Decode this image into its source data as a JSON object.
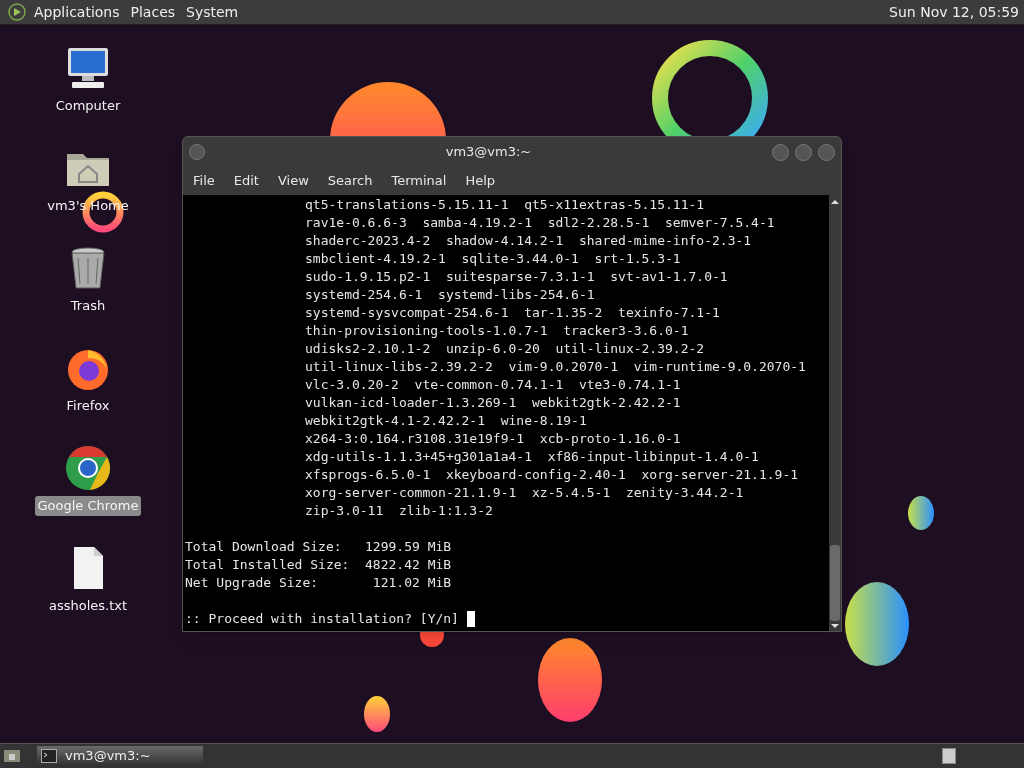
{
  "top_panel": {
    "menus": [
      "Applications",
      "Places",
      "System"
    ],
    "clock": "Sun Nov 12, 05:59"
  },
  "desktop_icons": [
    {
      "kind": "computer",
      "label": "Computer",
      "selected": false
    },
    {
      "kind": "home",
      "label": "vm3's Home",
      "selected": false
    },
    {
      "kind": "trash",
      "label": "Trash",
      "selected": false
    },
    {
      "kind": "firefox",
      "label": "Firefox",
      "selected": false
    },
    {
      "kind": "chrome",
      "label": "Google Chrome",
      "selected": true
    },
    {
      "kind": "file",
      "label": "assholes.txt",
      "selected": false
    }
  ],
  "terminal": {
    "title": "vm3@vm3:~",
    "menu": [
      "File",
      "Edit",
      "View",
      "Search",
      "Terminal",
      "Help"
    ],
    "package_lines": [
      "qt5-translations-5.15.11-1  qt5-x11extras-5.15.11-1",
      "rav1e-0.6.6-3  samba-4.19.2-1  sdl2-2.28.5-1  semver-7.5.4-1",
      "shaderc-2023.4-2  shadow-4.14.2-1  shared-mime-info-2.3-1",
      "smbclient-4.19.2-1  sqlite-3.44.0-1  srt-1.5.3-1",
      "sudo-1.9.15.p2-1  suitesparse-7.3.1-1  svt-av1-1.7.0-1",
      "systemd-254.6-1  systemd-libs-254.6-1",
      "systemd-sysvcompat-254.6-1  tar-1.35-2  texinfo-7.1-1",
      "thin-provisioning-tools-1.0.7-1  tracker3-3.6.0-1",
      "udisks2-2.10.1-2  unzip-6.0-20  util-linux-2.39.2-2",
      "util-linux-libs-2.39.2-2  vim-9.0.2070-1  vim-runtime-9.0.2070-1",
      "vlc-3.0.20-2  vte-common-0.74.1-1  vte3-0.74.1-1",
      "vulkan-icd-loader-1.3.269-1  webkit2gtk-2.42.2-1",
      "webkit2gtk-4.1-2.42.2-1  wine-8.19-1",
      "x264-3:0.164.r3108.31e19f9-1  xcb-proto-1.16.0-1",
      "xdg-utils-1.1.3+45+g301a1a4-1  xf86-input-libinput-1.4.0-1",
      "xfsprogs-6.5.0-1  xkeyboard-config-2.40-1  xorg-server-21.1.9-1",
      "xorg-server-common-21.1.9-1  xz-5.4.5-1  zenity-3.44.2-1",
      "zip-3.0-11  zlib-1:1.3-2"
    ],
    "summary_lines": [
      "Total Download Size:   1299.59 MiB",
      "Total Installed Size:  4822.42 MiB",
      "Net Upgrade Size:       121.02 MiB"
    ],
    "prompt": ":: Proceed with installation? [Y/n]"
  },
  "taskbar": {
    "tasks": [
      {
        "label": "vm3@vm3:~",
        "selected": true
      }
    ]
  }
}
